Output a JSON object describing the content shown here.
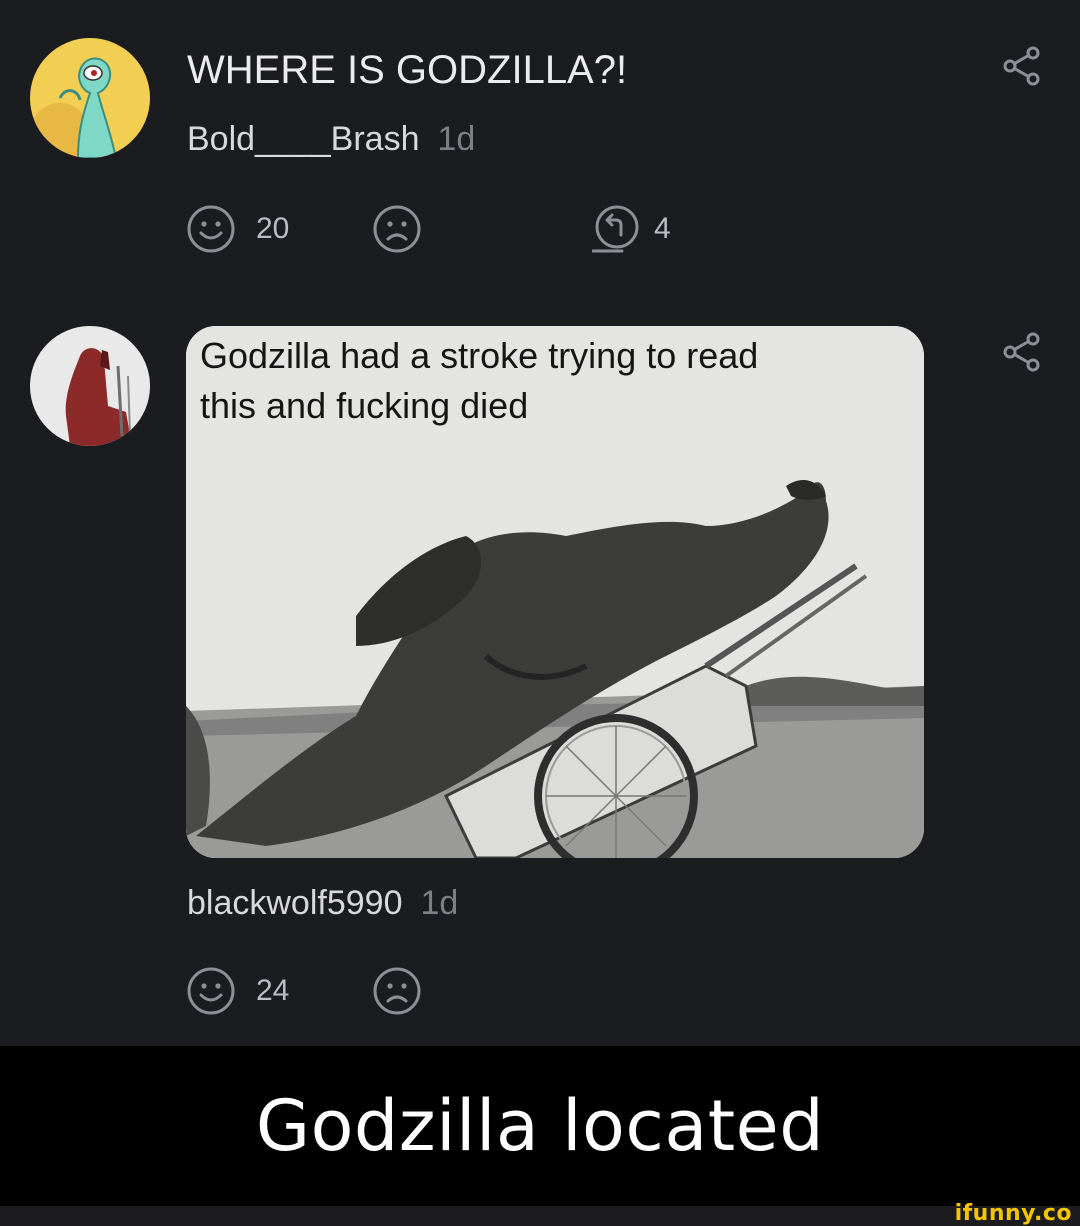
{
  "comments": [
    {
      "text": "WHERE IS GODZILLA?!",
      "username": "Bold____Brash",
      "time": "1d",
      "likes": "20",
      "replies": "4",
      "avatar": "squidward-painting-avatar"
    },
    {
      "image_caption": "Godzilla had a stroke trying to read this and fucking died",
      "image": "godzilla-in-wheelbarrow-photo",
      "username": "blackwolf5990",
      "time": "1d",
      "likes": "24",
      "avatar": "red-figure-avatar"
    }
  ],
  "banner": {
    "text": "Godzilla located"
  },
  "watermark": "ifunny.co",
  "colors": {
    "background": "#1b1c20",
    "banner": "#000000",
    "watermark": "#f5c400",
    "icon": "#8e8f95"
  },
  "icons": [
    "smile-icon",
    "frown-icon",
    "reply-icon",
    "share-icon"
  ]
}
